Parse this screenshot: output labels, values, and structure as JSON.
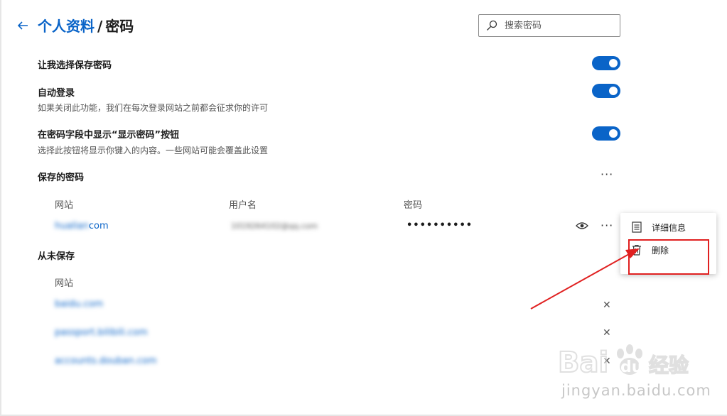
{
  "header": {
    "breadcrumb_parent": "个人资料",
    "breadcrumb_separator": "/",
    "breadcrumb_current": "密码"
  },
  "search": {
    "placeholder": "搜索密码"
  },
  "settings": [
    {
      "title": "让我选择保存密码",
      "description": "",
      "enabled": true
    },
    {
      "title": "自动登录",
      "description": "如果关闭此功能，我们在每次登录网站之前都会征求你的许可",
      "enabled": true
    },
    {
      "title": "在密码字段中显示“显示密码”按钮",
      "description": "选择此按钮将显示你键入的内容。一些网站可能会覆盖此设置",
      "enabled": true
    }
  ],
  "saved_passwords": {
    "title": "保存的密码",
    "more": "···",
    "columns": [
      "网站",
      "用户名",
      "密码"
    ],
    "rows": [
      {
        "site_blurred": "hualian",
        "site_suffix": "com",
        "username": "1019264102@qq.com",
        "password": "••••••••••"
      }
    ]
  },
  "never_saved": {
    "title": "从未保存",
    "column": "网站",
    "sites": [
      "baidu.com",
      "passport.bilibili.com",
      "accounts.douban.com"
    ]
  },
  "context_menu": {
    "items": [
      {
        "label": "详细信息",
        "icon": "details-list-icon"
      },
      {
        "label": "删除",
        "icon": "trash-icon"
      }
    ]
  },
  "colors": {
    "accent": "#0a64c8",
    "annotation": "#e02020"
  },
  "watermark": {
    "logo": "Bai du 经验",
    "url": "jingyan.baidu.com"
  }
}
